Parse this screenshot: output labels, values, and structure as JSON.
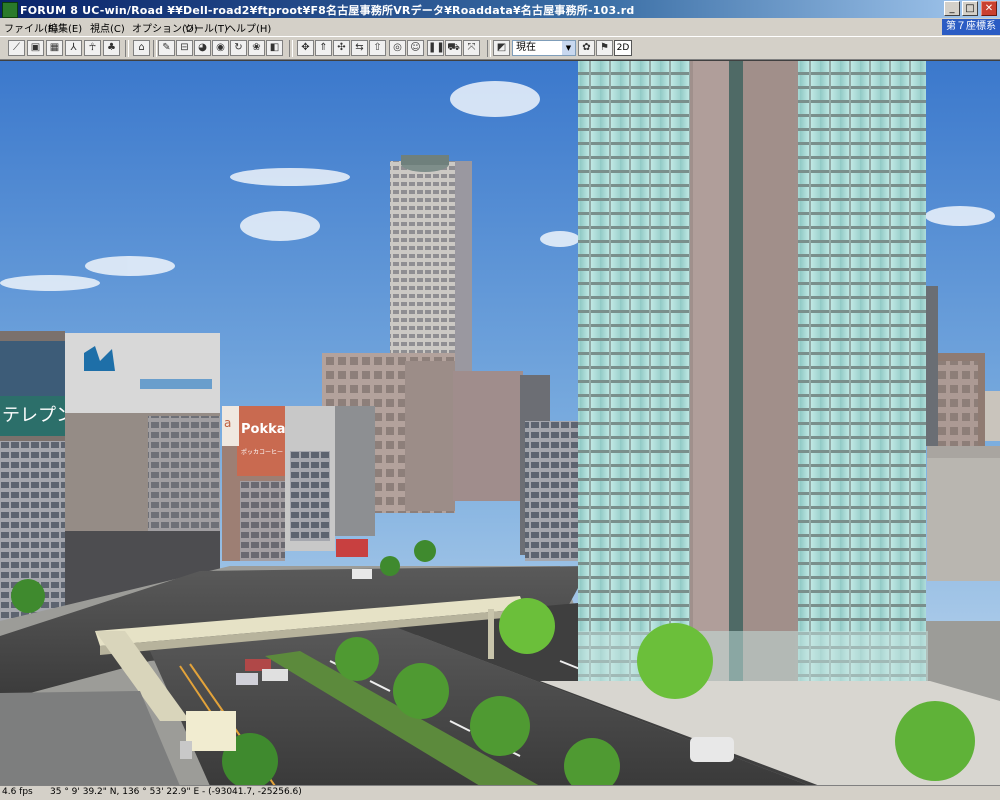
{
  "window": {
    "title": "FORUM 8    UC-win/Road    ¥¥Dell-road2¥ftproot¥F8名古屋事務所VRデータ¥Roaddata¥名古屋事務所-103.rd",
    "minimize": "_",
    "maximize": "□",
    "close": "✕"
  },
  "menu": [
    {
      "label": "ファイル(F)"
    },
    {
      "label": "編集(E)"
    },
    {
      "label": "視点(C)"
    },
    {
      "label": "オプション(O)"
    },
    {
      "label": "ツール(T)"
    },
    {
      "label": "ヘルプ(H)"
    }
  ],
  "coordinate_system": "第７座標系",
  "toolbar": {
    "time_select": "現在",
    "btn_2d": "2D"
  },
  "viewport": {
    "billboard_left": "テレプン",
    "sign_pokka_1": "Pokka",
    "sign_pokka_2": "ポッカコーヒー",
    "sign_a": "a"
  },
  "status": {
    "fps": "4.6 fps",
    "coordinates": "35 °  9' 39.2\" N, 136 °  53' 22.9\" E  -  (-93041.7, -25256.6)"
  },
  "colors": {
    "title_bar": "#0a246a",
    "sky_top": "#3f7fd0",
    "sky_bottom": "#c8dcef",
    "road": "#4a4a4a",
    "tower_glass": "#a8d6d4"
  }
}
